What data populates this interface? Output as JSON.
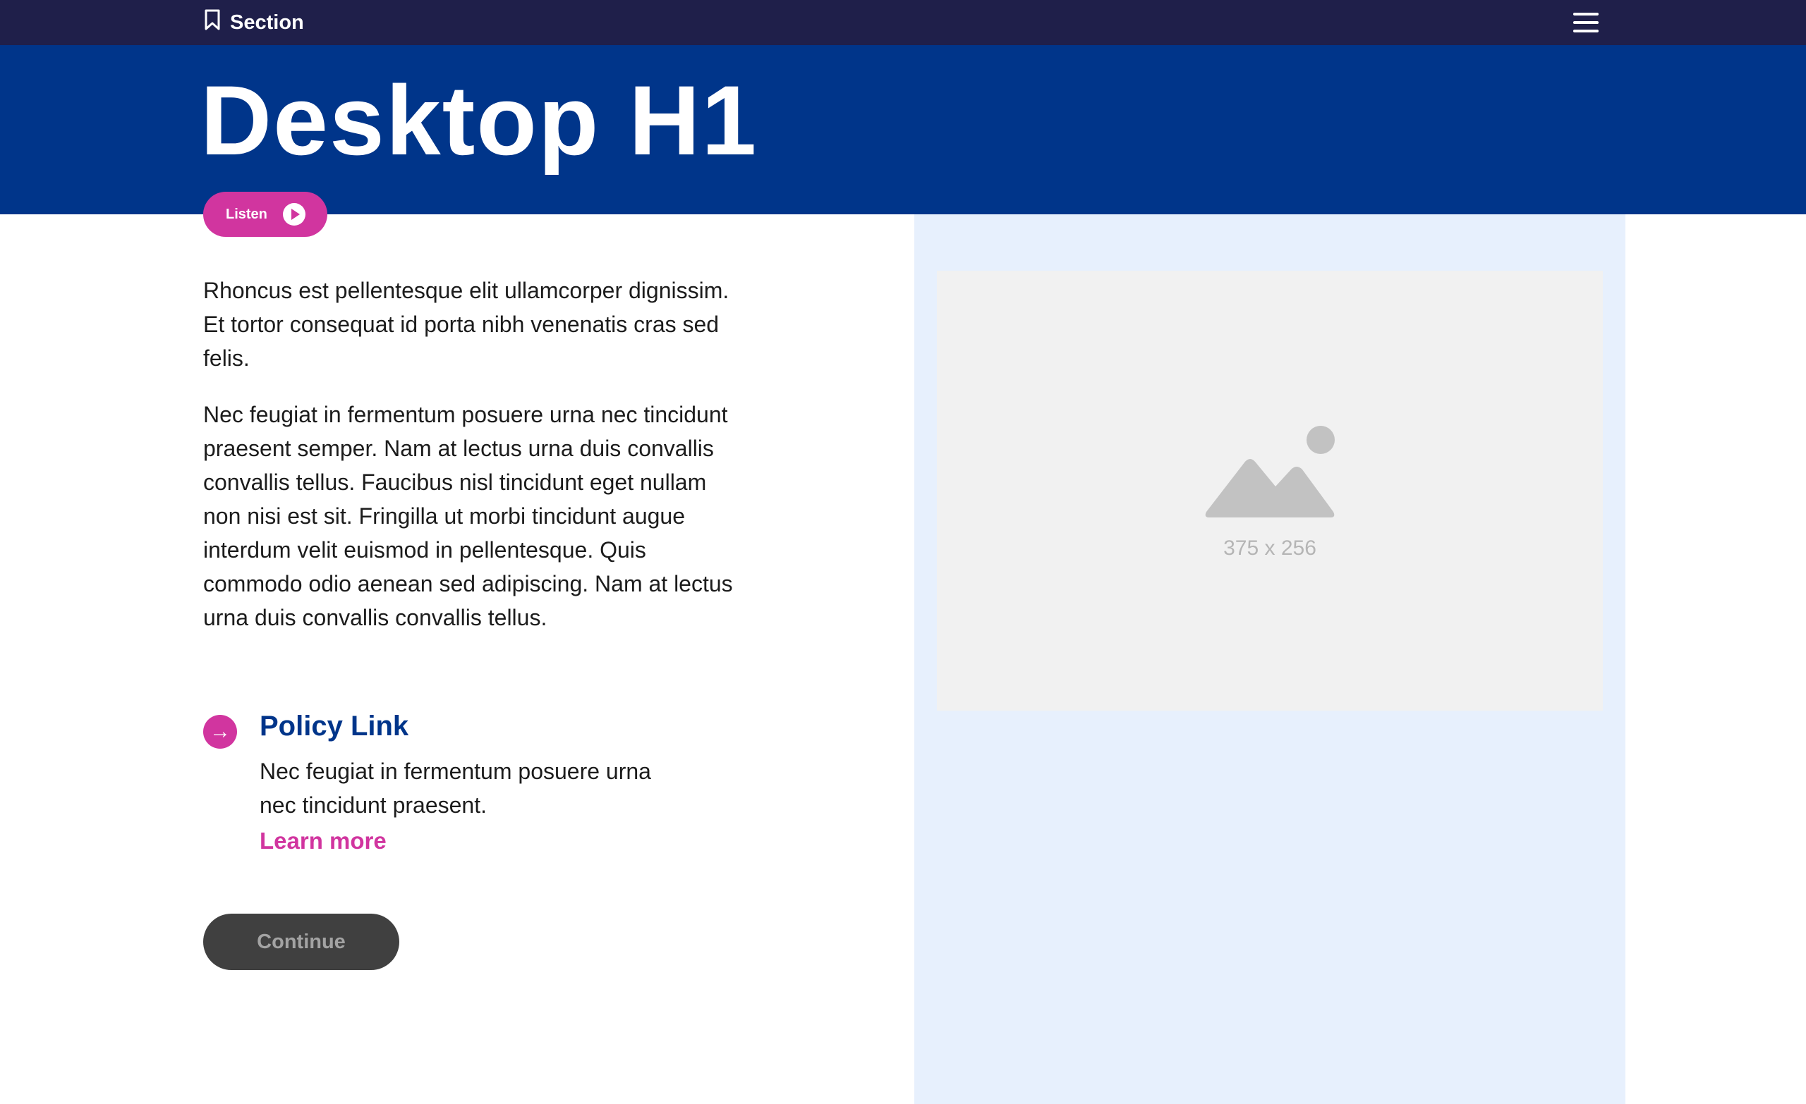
{
  "topbar": {
    "section_label": "Section",
    "menu_icon": "hamburger-menu-icon",
    "bookmark_icon": "bookmark-icon"
  },
  "hero": {
    "title": "Desktop H1"
  },
  "listen": {
    "label": "Listen",
    "icon": "play-icon"
  },
  "content": {
    "paragraph_1": "Rhoncus est pellentesque elit ullamcorper dignissim. Et tortor consequat id porta nibh venenatis cras sed felis.",
    "paragraph_2": "Nec feugiat in fermentum posuere urna nec tincidunt praesent semper. Nam at lectus urna duis convallis convallis tellus. Faucibus nisl tincidunt eget nullam non nisi est sit. Fringilla ut morbi tincidunt augue interdum velit euismod in pellentesque. Quis commodo odio aenean sed adipiscing. Nam at lectus urna duis convallis convallis tellus."
  },
  "policy": {
    "title": "Policy Link",
    "description": "Nec feugiat in fermentum posuere urna nec tincidunt praesent.",
    "learn_more": "Learn more",
    "arrow": "→"
  },
  "continue": {
    "label": "Continue"
  },
  "image_placeholder": {
    "dimensions": "375 x 256",
    "icon": "image-placeholder-icon"
  },
  "colors": {
    "topbar_bg": "#1f1f4a",
    "hero_bg": "#00358a",
    "accent": "#d1359f",
    "aside_bg": "#e7f0fd",
    "button_bg": "#404040"
  }
}
